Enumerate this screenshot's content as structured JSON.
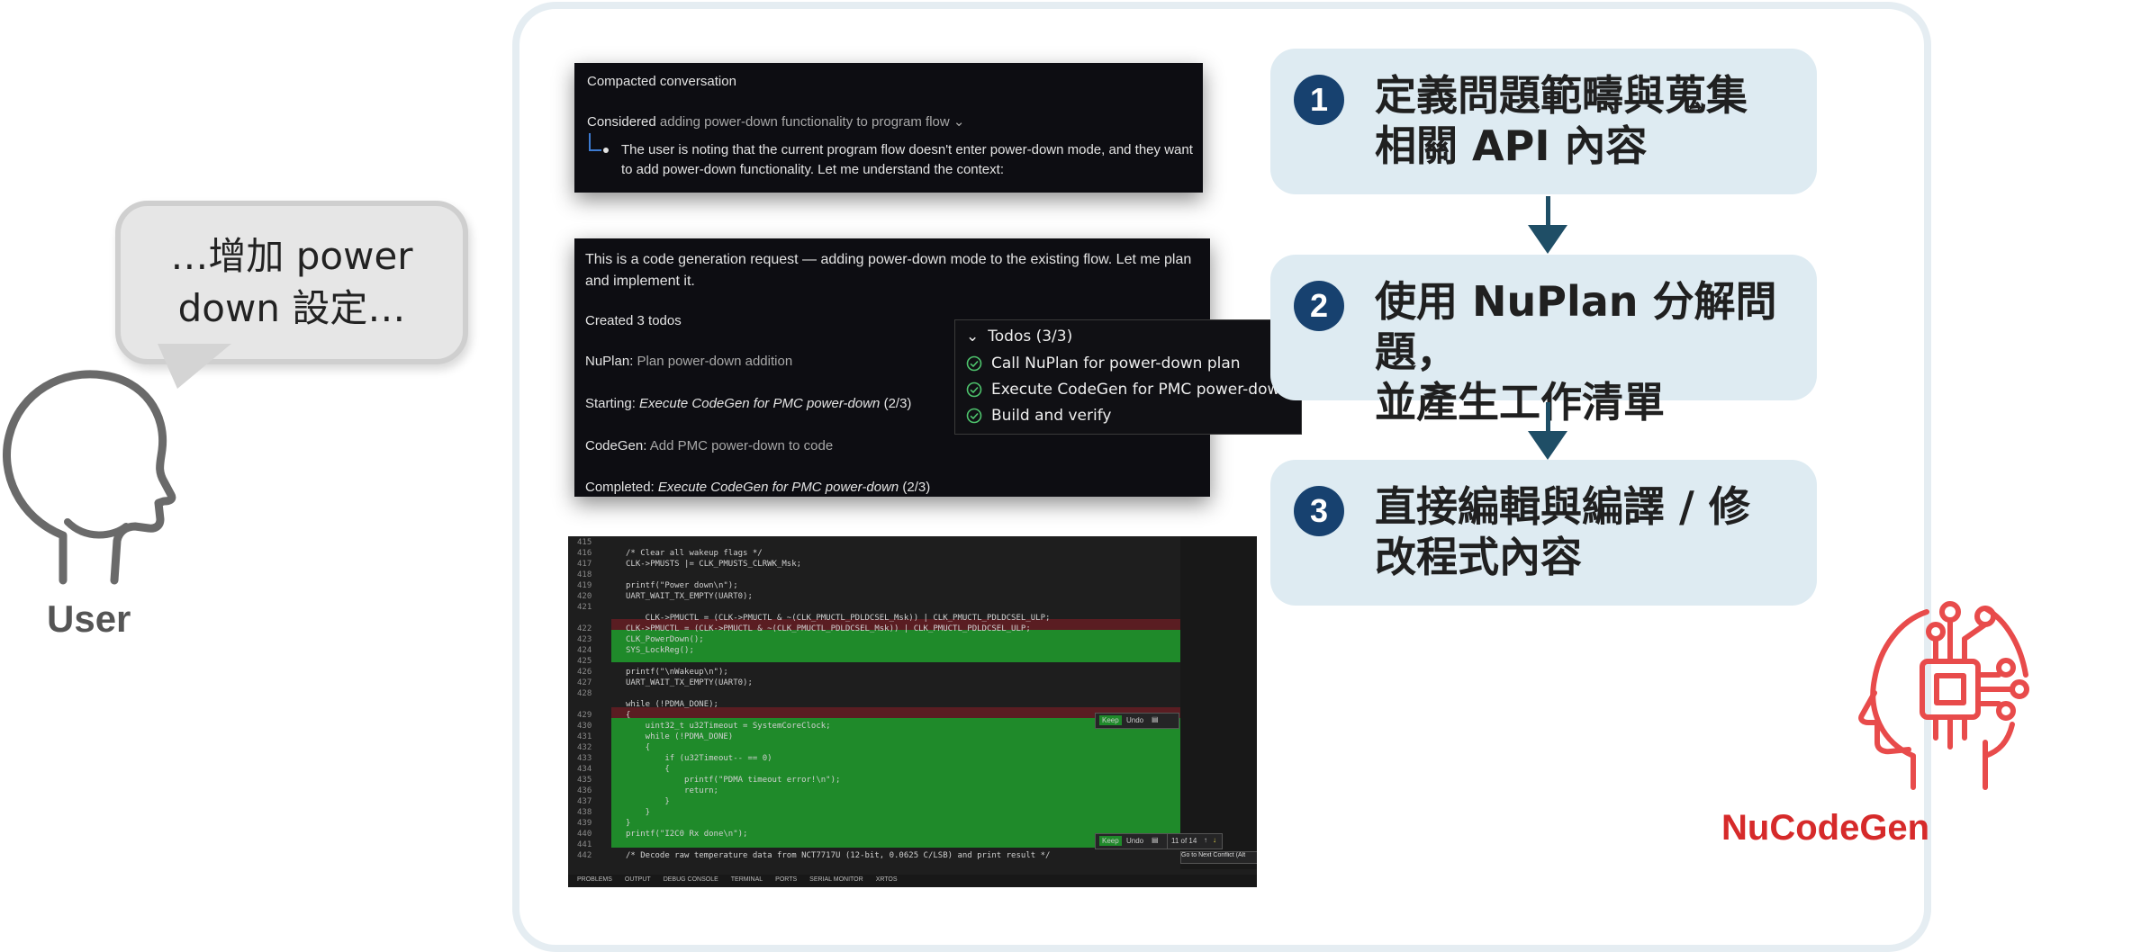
{
  "user": {
    "bubble_line1": "…增加 power",
    "bubble_line2": "down 設定…",
    "label": "User"
  },
  "card1": {
    "title": "Compacted conversation",
    "considered_prefix": "Considered",
    "considered_text": "adding power-down functionality to program flow ⌄",
    "bullet_line1": "The user is noting that the current program flow doesn't enter power-down mode, and they want",
    "bullet_line2": "to add power-down functionality. Let me understand the context:"
  },
  "card2": {
    "intro_line1": "This is a code generation request — adding power-down mode to the existing flow. Let me plan",
    "intro_line2": "and implement it.",
    "created": "Created 3 todos",
    "nuplan_prefix": "NuPlan:",
    "nuplan_text": "Plan power-down addition",
    "starting_prefix": "Starting:",
    "starting_text": "Execute CodeGen for PMC power-down",
    "starting_count": "(2/3)",
    "codegen_prefix": "CodeGen:",
    "codegen_text": "Add PMC power-down to code",
    "completed_prefix": "Completed:",
    "completed_text": "Execute CodeGen for PMC power-down",
    "completed_count": "(2/3)"
  },
  "todos": {
    "header": "Todos (3/3)",
    "items": [
      "Call NuPlan for power-down plan",
      "Execute CodeGen for PMC power-down",
      "Build and verify"
    ]
  },
  "editor": {
    "lines": [
      {
        "n": "415",
        "code": ""
      },
      {
        "n": "416",
        "code": "/* Clear all wakeup flags */"
      },
      {
        "n": "417",
        "code": "CLK->PMUSTS |= CLK_PMUSTS_CLRWK_Msk;"
      },
      {
        "n": "418",
        "code": ""
      },
      {
        "n": "419",
        "code": "printf(\"Power down\\n\");"
      },
      {
        "n": "420",
        "code": "UART_WAIT_TX_EMPTY(UART0);"
      },
      {
        "n": "421",
        "code": ""
      },
      {
        "n": "",
        "code": "    CLK->PMUCTL = (CLK->PMUCTL & ~(CLK_PMUCTL_PDLDCSEL_Msk)) | CLK_PMUCTL_PDLDCSEL_ULP;"
      },
      {
        "n": "422",
        "code": "CLK->PMUCTL = (CLK->PMUCTL & ~(CLK_PMUCTL_PDLDCSEL_Msk)) | CLK_PMUCTL_PDLDCSEL_ULP;"
      },
      {
        "n": "423",
        "code": "CLK_PowerDown();"
      },
      {
        "n": "424",
        "code": "SYS_LockReg();"
      },
      {
        "n": "425",
        "code": ""
      },
      {
        "n": "426",
        "code": "printf(\"\\nWakeup\\n\");"
      },
      {
        "n": "427",
        "code": "UART_WAIT_TX_EMPTY(UART0);"
      },
      {
        "n": "428",
        "code": ""
      },
      {
        "n": "",
        "code": "while (!PDMA_DONE);"
      },
      {
        "n": "429",
        "code": "{"
      },
      {
        "n": "430",
        "code": "    uint32_t u32Timeout = SystemCoreClock;"
      },
      {
        "n": "431",
        "code": "    while (!PDMA_DONE)"
      },
      {
        "n": "432",
        "code": "    {"
      },
      {
        "n": "433",
        "code": "        if (u32Timeout-- == 0)"
      },
      {
        "n": "434",
        "code": "        {"
      },
      {
        "n": "435",
        "code": "            printf(\"PDMA timeout error!\\n\");"
      },
      {
        "n": "436",
        "code": "            return;"
      },
      {
        "n": "437",
        "code": "        }"
      },
      {
        "n": "438",
        "code": "    }"
      },
      {
        "n": "439",
        "code": "}"
      },
      {
        "n": "440",
        "code": "printf(\"I2C0 Rx done\\n\");"
      },
      {
        "n": "441",
        "code": ""
      },
      {
        "n": "442",
        "code": "/* Decode raw temperature data from NCT7717U (12-bit, 0.0625 C/LSB) and print result */"
      }
    ],
    "keep_label": "Keep",
    "undo_label": "Undo",
    "counter": "11 of 14",
    "tooltip": "Go to Next Conflict (Alt",
    "status_tabs": [
      "PROBLEMS",
      "OUTPUT",
      "DEBUG CONSOLE",
      "TERMINAL",
      "PORTS",
      "SERIAL MONITOR",
      "XRTOS"
    ]
  },
  "steps": [
    {
      "num": "1",
      "line1": "定義問題範疇與蒐集",
      "line2": "相關 API 內容"
    },
    {
      "num": "2",
      "line1": "使用 NuPlan 分解問題，",
      "line2": "並產生工作清單"
    },
    {
      "num": "3",
      "line1": "直接編輯與編譯 / 修",
      "line2": "改程式內容"
    }
  ],
  "nucodegen": {
    "label": "NuCodeGen"
  },
  "colors": {
    "step_bg": "#deebf2",
    "step_num": "#17416f",
    "arrow": "#1f4e66",
    "accent_red": "#d62a2a"
  }
}
